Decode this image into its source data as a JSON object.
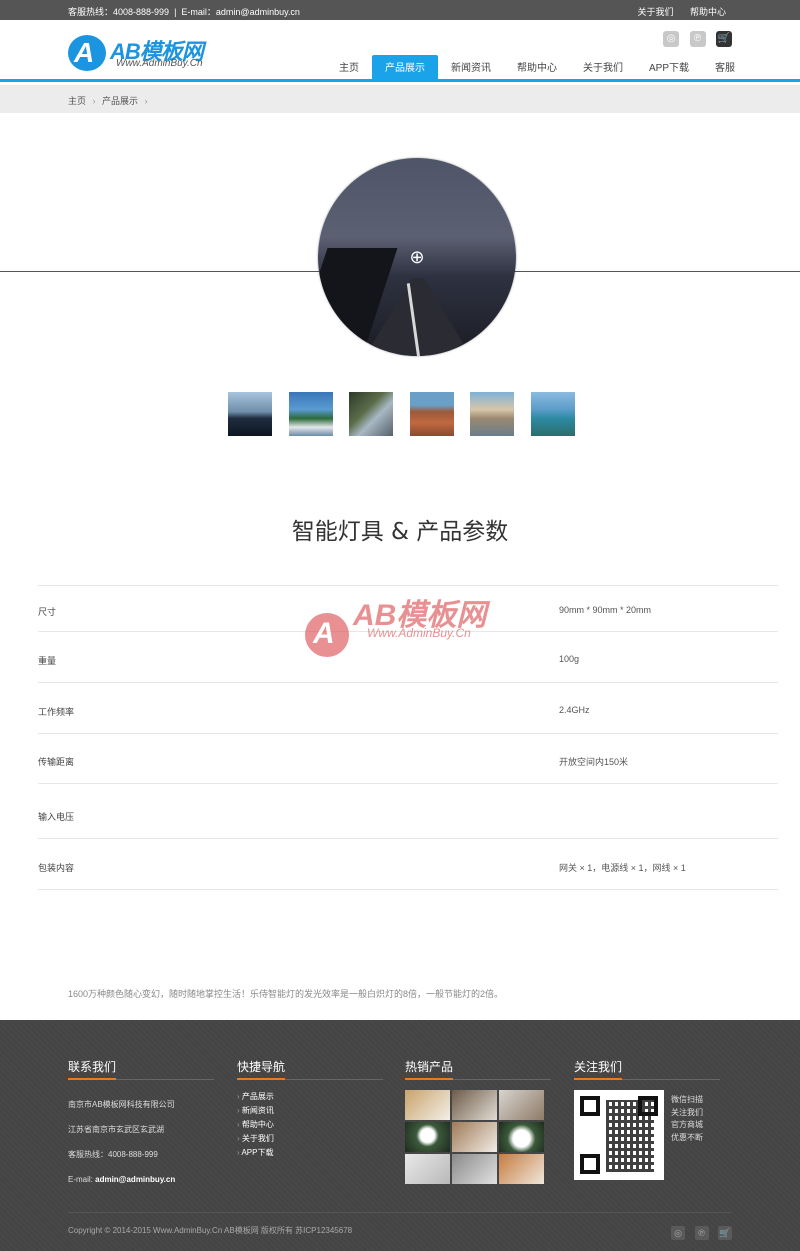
{
  "topbar": {
    "hotline": "客服热线：4008-888-999",
    "email": "E-mail：admin@adminbuy.cn",
    "links": [
      "关于我们",
      "帮助中心"
    ]
  },
  "logo": {
    "mark": "A",
    "name": "AB模板网",
    "url": "Www.AdminBuy.Cn"
  },
  "header_icons": [
    "weibo-icon",
    "pinterest-icon",
    "cart-icon"
  ],
  "nav": {
    "items": [
      "主页",
      "产品展示",
      "新闻资讯",
      "帮助中心",
      "关于我们",
      "APP下载",
      "客服"
    ],
    "active_index": 1
  },
  "breadcrumb": [
    "主页",
    "产品展示"
  ],
  "product": {
    "title": "智能灯具 & 产品参数",
    "specs": [
      {
        "key": "尺寸",
        "value": "90mm * 90mm * 20mm"
      },
      {
        "key": "重量",
        "value": "100g"
      },
      {
        "key": "工作频率",
        "value": "2.4GHz"
      },
      {
        "key": "传输距离",
        "value": "开放空间内150米"
      },
      {
        "key": "输入电压",
        "value": ""
      },
      {
        "key": "包装内容",
        "value": "网关 × 1，电源线 × 1，网线 × 1"
      }
    ],
    "description": "1600万种颜色随心变幻，随时随地掌控生活！乐侍智能灯的发光效率是一般白炽灯的8倍，一般节能灯的2倍。"
  },
  "watermark": {
    "mark": "A",
    "name": "AB模板网",
    "url": "Www.AdminBuy.Cn"
  },
  "footer": {
    "contact": {
      "title": "联系我们",
      "company": "南京市AB模板网科技有限公司",
      "address": "江苏省南京市玄武区玄武湖",
      "hotline": "客服热线：4008-888-999",
      "email_label": "E-mail:",
      "email": "admin@adminbuy.cn"
    },
    "quick_nav": {
      "title": "快捷导航",
      "items": [
        "产品展示",
        "新闻资讯",
        "帮助中心",
        "关于我们",
        "APP下载"
      ]
    },
    "hot_products": {
      "title": "热销产品"
    },
    "follow": {
      "title": "关注我们",
      "lines": [
        "微信扫描",
        "关注我们",
        "官方商城",
        "优惠不断"
      ]
    },
    "copyright": "Copyright © 2014-2015 Www.AdminBuy.Cn AB模板网 版权所有  苏ICP12345678"
  },
  "colors": {
    "accent": "#1aa3e8",
    "footer_accent": "#e97a1d",
    "watermark": "#d9484b"
  }
}
